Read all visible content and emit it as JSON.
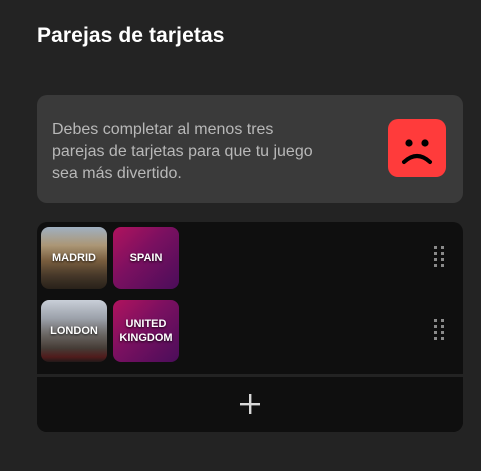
{
  "panel": {
    "title": "Parejas de tarjetas"
  },
  "warning": {
    "lines": [
      "Debes completar al menos tres",
      "parejas de tarjetas para que tu juego",
      "sea más divertido."
    ],
    "icon": "sad-face-icon",
    "icon_color": "#ff3b3b"
  },
  "pairs": [
    {
      "left_label": "MADRID",
      "right_label": "SPAIN",
      "right_lines": [
        "SPAIN"
      ]
    },
    {
      "left_label": "LONDON",
      "right_label": "UNITED KINGDOM",
      "right_lines": [
        "UNITED",
        "KINGDOM"
      ]
    }
  ],
  "add_button": {
    "icon": "plus-icon"
  },
  "colors": {
    "background": "#232323",
    "card_gradient_start": "#b0135e",
    "card_gradient_end": "#4a0d5a"
  }
}
